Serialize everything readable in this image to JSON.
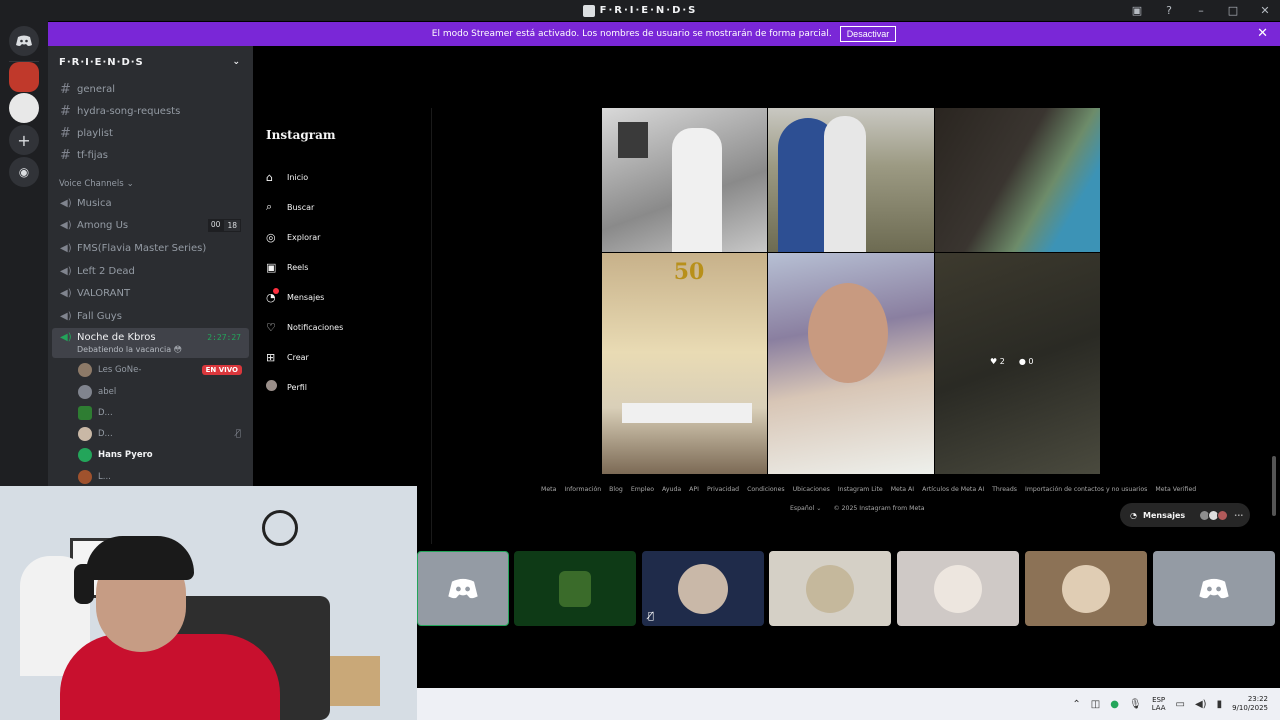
{
  "window": {
    "title": "F·R·I·E·N·D·S"
  },
  "banner": {
    "text": "El modo Streamer está activado. Los nombres de usuario se mostrarán de forma parcial.",
    "button": "Desactivar"
  },
  "guild": {
    "name": "F·R·I·E·N·D·S"
  },
  "text_channels": [
    "general",
    "hydra-song-requests",
    "playlist",
    "tf-fijas"
  ],
  "voice_category": "Voice Channels",
  "voice_channels": [
    {
      "name": "Musica"
    },
    {
      "name": "Among Us",
      "badge_a": "00",
      "badge_b": "18"
    },
    {
      "name": "FMS(Flavia Master Series)"
    },
    {
      "name": "Left 2 Dead"
    },
    {
      "name": "VALORANT"
    },
    {
      "name": "Fall Guys"
    }
  ],
  "active_channel": {
    "name": "Noche de Kbros",
    "timer": "2:27:27",
    "status": "Debatiendo la vacancia 😳"
  },
  "members": [
    {
      "name": "Les GoNe-",
      "badge": "EN VIVO"
    },
    {
      "name": "abel"
    },
    {
      "name": "D..."
    },
    {
      "name": "D..."
    },
    {
      "name": "Hans Pyero"
    },
    {
      "name": "L..."
    }
  ],
  "instagram": {
    "logo": "Instagram",
    "nav": [
      "Inicio",
      "Buscar",
      "Explorar",
      "Reels",
      "Mensajes",
      "Notificaciones",
      "Crear",
      "Perfil"
    ],
    "overlay": {
      "likes": "2",
      "comments": "0"
    },
    "footer_links": [
      "Meta",
      "Información",
      "Blog",
      "Empleo",
      "Ayuda",
      "API",
      "Privacidad",
      "Condiciones",
      "Ubicaciones",
      "Instagram Lite",
      "Meta AI",
      "Artículos de Meta AI",
      "Threads",
      "Importación de contactos y no usuarios",
      "Meta Verified"
    ],
    "language": "Español",
    "copyright": "© 2025 Instagram from Meta",
    "messages_label": "Mensajes",
    "tile_text": "50"
  },
  "taskbar": {
    "lang_top": "ESP",
    "lang_bottom": "LAA",
    "time": "23:22",
    "date": "9/10/2025"
  },
  "colors": {
    "banner": "#7a27d7",
    "live": "#da373c",
    "green": "#23a55a",
    "blurple": "#5865f2"
  }
}
